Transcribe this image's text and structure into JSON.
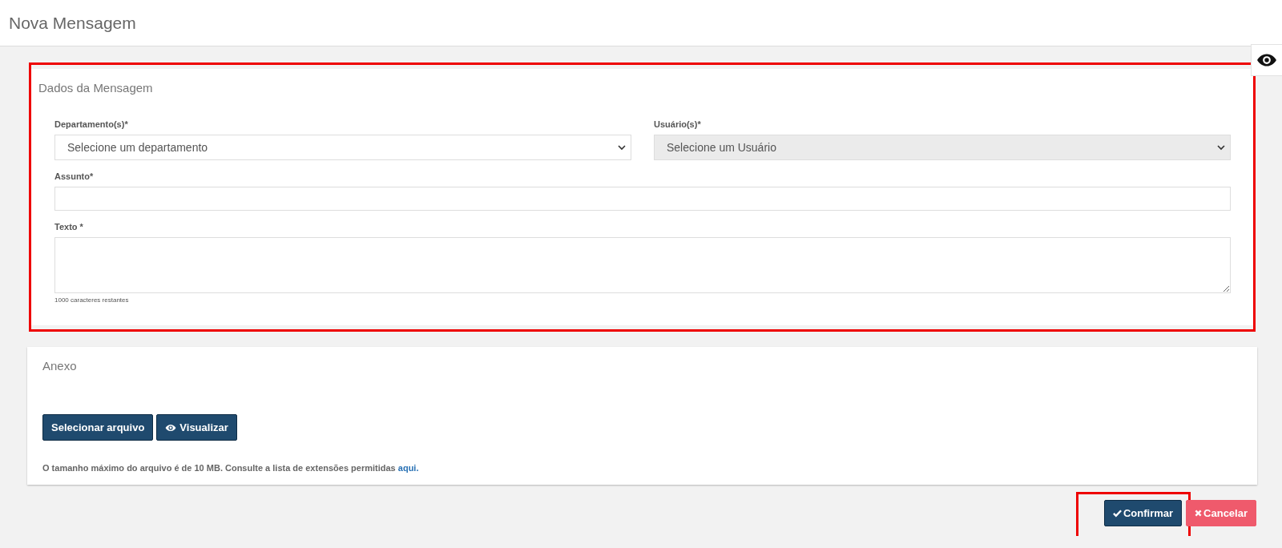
{
  "page": {
    "title": "Nova Mensagem"
  },
  "message_card": {
    "title": "Dados da Mensagem",
    "highlighted": true,
    "fields": [
      {
        "kind": "select",
        "label": "Departamento(s)*",
        "placeholder": "Selecione um departamento",
        "disabled": false
      },
      {
        "kind": "select",
        "label": "Usuário(s)*",
        "placeholder": "Selecione um Usuário",
        "disabled": true
      },
      {
        "kind": "input",
        "label": "Assunto*"
      },
      {
        "kind": "textarea",
        "label": "Texto *",
        "counter": "1000 caracteres restantes"
      }
    ]
  },
  "attachment_card": {
    "title": "Anexo",
    "buttons": [
      {
        "label": "Selecionar arquivo",
        "kind": "select"
      },
      {
        "label": "Visualizar",
        "kind": "preview"
      }
    ],
    "note": "O tamanho máximo do arquivo é de 10 MB. Consulte a lista de extensões permitidas",
    "note_link": "aqui."
  },
  "actions": [
    {
      "kind": "confirm",
      "label": "Confirmar",
      "highlighted": true
    },
    {
      "kind": "cancel",
      "label": "Cancelar",
      "highlighted": false
    }
  ]
}
